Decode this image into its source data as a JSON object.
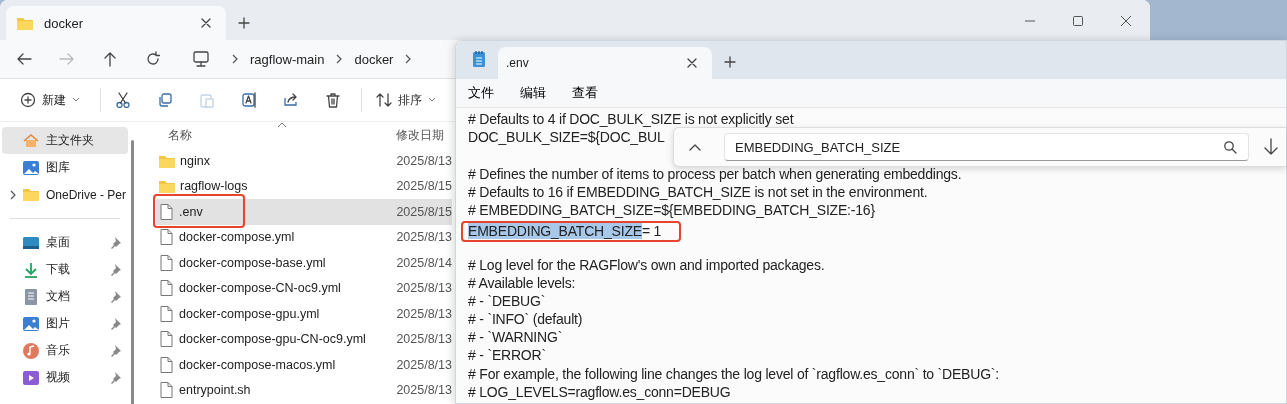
{
  "explorer": {
    "tab": {
      "title": "docker",
      "selected": true
    },
    "window_controls": [
      {
        "kind": "minimize"
      },
      {
        "kind": "maximize"
      },
      {
        "kind": "close"
      }
    ],
    "nav": [
      {
        "kind": "back",
        "disabled": false
      },
      {
        "kind": "forward",
        "disabled": true
      },
      {
        "kind": "up",
        "disabled": false
      },
      {
        "kind": "refresh",
        "disabled": false
      }
    ],
    "breadcrumb": [
      "ragflow-main",
      "docker"
    ],
    "toolbar": [
      {
        "kind": "new",
        "label": "新建",
        "disabled": false
      },
      {
        "kind": "cut",
        "disabled": false
      },
      {
        "kind": "copy",
        "disabled": false
      },
      {
        "kind": "paste",
        "disabled": true
      },
      {
        "kind": "rename",
        "disabled": false
      },
      {
        "kind": "share",
        "disabled": false
      },
      {
        "kind": "delete",
        "disabled": false
      },
      {
        "kind": "sort",
        "label": "排序",
        "disabled": false
      }
    ],
    "sidebar": {
      "groups": [
        [
          {
            "label": "主文件夹",
            "kind": "home",
            "selected": true,
            "pinned": false,
            "expandable": false
          },
          {
            "label": "图库",
            "kind": "gallery",
            "selected": false,
            "pinned": false,
            "expandable": false
          },
          {
            "label": "OneDrive - Per",
            "kind": "folder",
            "selected": false,
            "pinned": false,
            "expandable": true
          }
        ],
        [
          {
            "label": "桌面",
            "kind": "desktop",
            "selected": false,
            "pinned": true,
            "expandable": false
          },
          {
            "label": "下载",
            "kind": "download",
            "selected": false,
            "pinned": true,
            "expandable": false
          },
          {
            "label": "文档",
            "kind": "document",
            "selected": false,
            "pinned": true,
            "expandable": false
          },
          {
            "label": "图片",
            "kind": "gallery",
            "selected": false,
            "pinned": true,
            "expandable": false
          },
          {
            "label": "音乐",
            "kind": "music",
            "selected": false,
            "pinned": true,
            "expandable": false
          },
          {
            "label": "视频",
            "kind": "video",
            "selected": false,
            "pinned": true,
            "expandable": false
          }
        ]
      ]
    },
    "files": {
      "columns": [
        "名称",
        "修改日期"
      ],
      "rows": [
        {
          "name": "nginx",
          "kind": "folder",
          "date": "2025/8/13",
          "selected": false,
          "boxed": false
        },
        {
          "name": "ragflow-logs",
          "kind": "folder",
          "date": "2025/8/15",
          "selected": false,
          "boxed": false
        },
        {
          "name": ".env",
          "kind": "file",
          "date": "2025/8/15",
          "selected": true,
          "boxed": true
        },
        {
          "name": "docker-compose.yml",
          "kind": "file",
          "date": "2025/8/13",
          "selected": false,
          "boxed": false
        },
        {
          "name": "docker-compose-base.yml",
          "kind": "file",
          "date": "2025/8/14",
          "selected": false,
          "boxed": false
        },
        {
          "name": "docker-compose-CN-oc9.yml",
          "kind": "file",
          "date": "2025/8/13",
          "selected": false,
          "boxed": false
        },
        {
          "name": "docker-compose-gpu.yml",
          "kind": "file",
          "date": "2025/8/13",
          "selected": false,
          "boxed": false
        },
        {
          "name": "docker-compose-gpu-CN-oc9.yml",
          "kind": "file",
          "date": "2025/8/13",
          "selected": false,
          "boxed": false
        },
        {
          "name": "docker-compose-macos.yml",
          "kind": "file",
          "date": "2025/8/13",
          "selected": false,
          "boxed": false
        },
        {
          "name": "entrypoint.sh",
          "kind": "file",
          "date": "2025/8/13",
          "selected": false,
          "boxed": false
        }
      ]
    }
  },
  "notepad": {
    "tab": {
      "title": ".env",
      "selected": true
    },
    "menu": [
      "文件",
      "编辑",
      "查看"
    ],
    "lines": [
      {
        "kind": "text",
        "text": "# Defaults to 4 if DOC_BULK_SIZE is not explicitly set"
      },
      {
        "kind": "text",
        "text": "DOC_BULK_SIZE=${DOC_BUL"
      },
      {
        "kind": "blank"
      },
      {
        "kind": "text",
        "text": "# Defines the number of items to process per batch when generating embeddings."
      },
      {
        "kind": "text",
        "text": "# Defaults to 16 if EMBEDDING_BATCH_SIZE is not set in the environment."
      },
      {
        "kind": "text",
        "text": "# EMBEDDING_BATCH_SIZE=${EMBEDDING_BATCH_SIZE:-16}"
      },
      {
        "kind": "text",
        "selected_text": "EMBEDDING_BATCH_SIZE",
        "text": "= 1",
        "boxed": true
      },
      {
        "kind": "blank"
      },
      {
        "kind": "text",
        "text": "# Log level for the RAGFlow's own and imported packages."
      },
      {
        "kind": "text",
        "text": "# Available levels:"
      },
      {
        "kind": "text",
        "text": "# - `DEBUG`"
      },
      {
        "kind": "text",
        "text": "# - `INFO` (default)"
      },
      {
        "kind": "text",
        "text": "# - `WARNING`"
      },
      {
        "kind": "text",
        "text": "# - `ERROR`"
      },
      {
        "kind": "text",
        "text": "# For example, the following line changes the log level of `ragflow.es_conn` to `DEBUG`:"
      },
      {
        "kind": "text",
        "text": "# LOG_LEVELS=ragflow.es_conn=DEBUG"
      }
    ],
    "find": {
      "value": "EMBEDDING_BATCH_SIZE"
    }
  }
}
